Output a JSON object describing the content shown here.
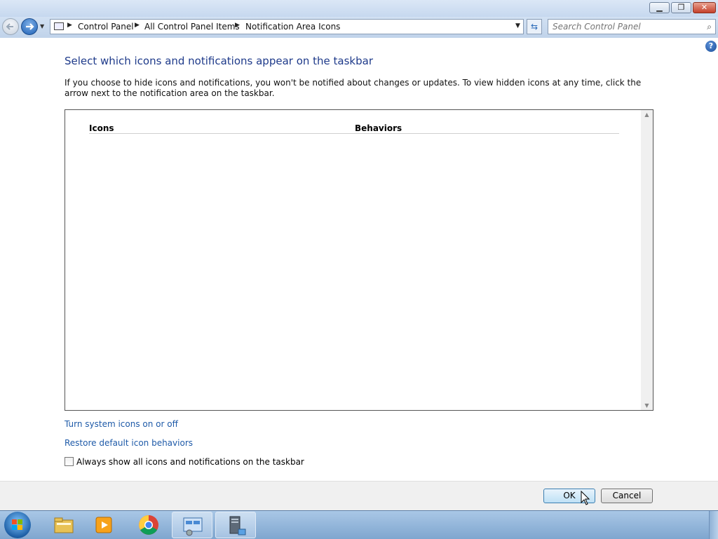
{
  "window": {
    "caption_buttons": {
      "minimize": "▁",
      "maximize": "❐",
      "close": "✕"
    }
  },
  "nav": {
    "breadcrumbs": [
      "Control Panel",
      "All Control Panel Items",
      "Notification Area Icons"
    ],
    "search_placeholder": "Search Control Panel",
    "icons": {
      "back": "back-arrow-icon",
      "forward": "forward-arrow-icon",
      "refresh": "refresh-icon",
      "search": "search-icon"
    }
  },
  "help": {
    "label": "?"
  },
  "main": {
    "heading": "Select which icons and notifications appear on the taskbar",
    "description": "If you choose to hide icons and notifications, you won't be notified about changes or updates. To view hidden icons at any time, click the arrow next to the notification area on the taskbar.",
    "columns": {
      "icons": "Icons",
      "behaviors": "Behaviors"
    },
    "links": {
      "system_icons": "Turn system icons on or off",
      "restore": "Restore default icon behaviors"
    },
    "always_show": {
      "label": "Always show all icons and notifications on the taskbar",
      "checked": false
    }
  },
  "footer": {
    "ok": "OK",
    "cancel": "Cancel"
  },
  "taskbar": {
    "items": [
      "windows-explorer-icon",
      "media-player-icon",
      "chrome-icon",
      "control-panel-icon",
      "server-manager-icon"
    ],
    "active_index": 3
  },
  "colors": {
    "link": "#1e5aa8",
    "heading": "#1e3a8a",
    "accent": "#3c7fb1"
  }
}
